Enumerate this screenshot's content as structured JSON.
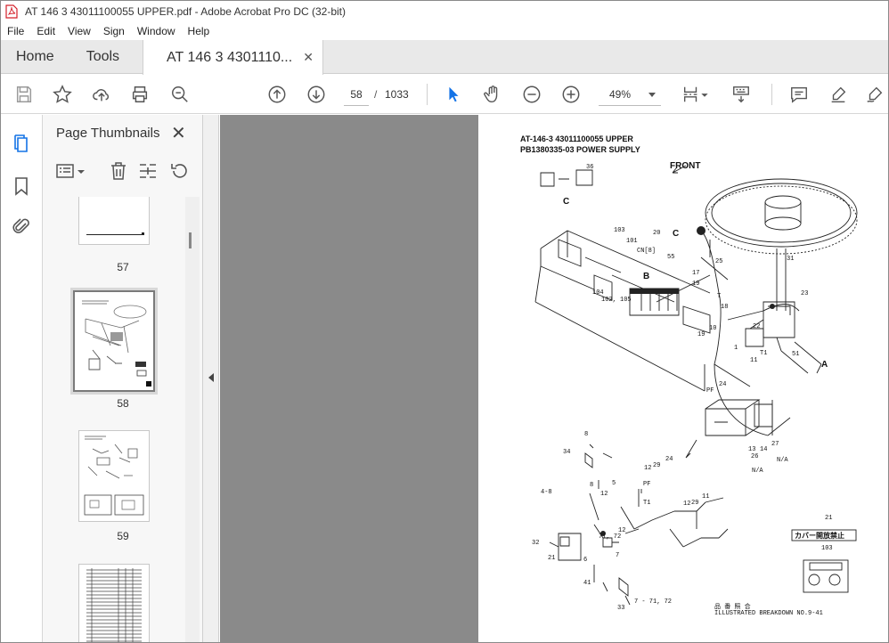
{
  "window": {
    "title": "AT 146 3 43011100055 UPPER.pdf - Adobe Acrobat Pro DC (32-bit)"
  },
  "menu": [
    "File",
    "Edit",
    "View",
    "Sign",
    "Window",
    "Help"
  ],
  "tabs": {
    "home": "Home",
    "tools": "Tools",
    "document": "AT 146 3 4301110..."
  },
  "toolbar": {
    "current_page": "58",
    "page_separator": "/",
    "total_pages": "1033",
    "zoom": "49%"
  },
  "thumbnail_panel": {
    "title": "Page Thumbnails",
    "pages": [
      {
        "label": "57"
      },
      {
        "label": "58",
        "selected": true
      },
      {
        "label": "59"
      },
      {
        "label": ""
      }
    ]
  },
  "document": {
    "header_line1": "AT-146-3 43011100055 UPPER",
    "header_line2": "PB1380335-03 POWER SUPPLY",
    "front_label": "FRONT",
    "view_labels": [
      "C",
      "B",
      "A",
      "C"
    ],
    "callouts": [
      "36",
      "103",
      "101",
      "20",
      "CN[8]",
      "55",
      "25",
      "17",
      "19",
      "104",
      "102, 105",
      "T",
      "31",
      "18",
      "23",
      "10",
      "22",
      "19",
      "1",
      "T1",
      "11",
      "51",
      "24",
      "PF",
      "13",
      "14",
      "26",
      "27",
      "N/A",
      "N/A",
      "8",
      "34",
      "12",
      "29",
      "24",
      "PF",
      "5",
      "12",
      "T1",
      "11",
      "29",
      "4-8",
      "8",
      "12",
      "7",
      "32",
      "71, 72",
      "12",
      "21",
      "6",
      "41",
      "21",
      "103",
      "33",
      "7 - 71, 72"
    ],
    "japanese_label": "カバー開放禁止",
    "footer_line1": "品 番 照 合",
    "footer_line2": "ILLUSTRATED BREAKDOWN NO.9-41"
  },
  "colors": {
    "accent_blue": "#1473e6",
    "acrobat_red": "#d4202a",
    "doc_background": "#8a8a8a"
  }
}
